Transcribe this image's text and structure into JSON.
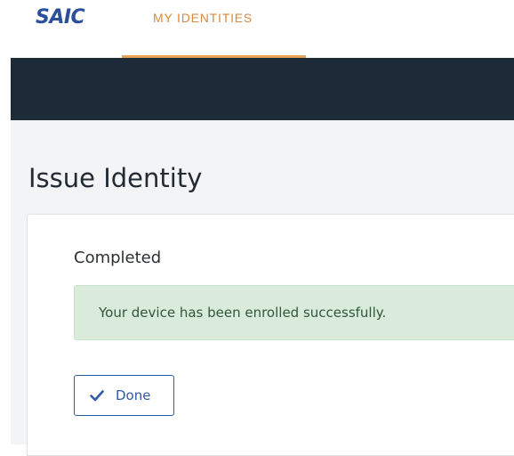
{
  "header": {
    "logo_text": "SAIC",
    "nav": {
      "active_tab_label": "MY IDENTITIES"
    }
  },
  "main": {
    "page_title": "Issue Identity",
    "card": {
      "status_label": "Completed",
      "alert": {
        "message": "Your device has been enrolled successfully.",
        "type": "success"
      },
      "done_button": {
        "label": "Done",
        "icon": "check-icon"
      }
    }
  },
  "colors": {
    "brand": "#2b4f9a",
    "active_tab": "#d6893f",
    "dark_band": "#1d2b38",
    "success_bg": "#d9ecdc",
    "button_accent": "#2f5aa8"
  }
}
